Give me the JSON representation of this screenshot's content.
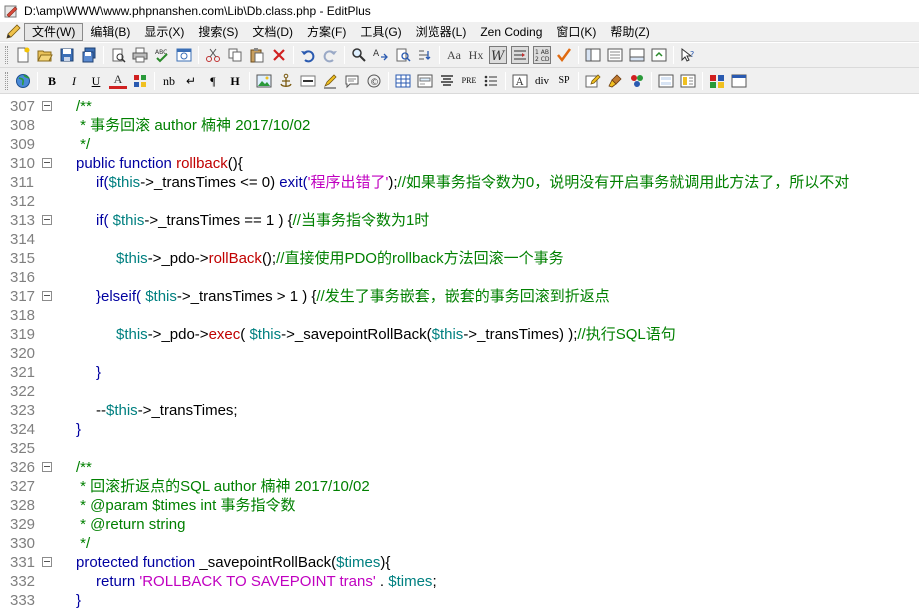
{
  "window": {
    "title": "D:\\amp\\WWW\\www.phpnanshen.com\\Lib\\Db.class.php - EditPlus"
  },
  "menu": [
    {
      "label": "文件(W)",
      "active": true
    },
    {
      "label": "编辑(B)"
    },
    {
      "label": "显示(X)"
    },
    {
      "label": "搜索(S)"
    },
    {
      "label": "文档(D)"
    },
    {
      "label": "方案(F)"
    },
    {
      "label": "工具(G)"
    },
    {
      "label": "浏览器(L)"
    },
    {
      "label": "Zen Coding"
    },
    {
      "label": "窗口(K)"
    },
    {
      "label": "帮助(Z)"
    }
  ],
  "toolbar2_labels": {
    "bold": "B",
    "italic": "I",
    "underline": "U",
    "font_color": "A",
    "nbsp": "nb",
    "line_break": "↵",
    "paragraph": "¶",
    "heading": "H",
    "pre": "PRE",
    "div": "div",
    "span": "SP"
  },
  "toolbar1_labels": {
    "font": "Aa",
    "hex": "Hx"
  },
  "colors": {
    "comment": "#008000",
    "keyword": "#0000a0",
    "function": "#c00000",
    "variable": "#008080",
    "string": "#c000c0",
    "line_number": "#7f7f7f"
  },
  "lines": [
    {
      "n": "307",
      "fold": true,
      "indent": 0,
      "tokens": [
        [
          "cm",
          "/**"
        ]
      ]
    },
    {
      "n": "308",
      "fold": false,
      "indent": 0,
      "tokens": [
        [
          "cm",
          " * 事务回滚 author 楠神 2017/10/02"
        ]
      ]
    },
    {
      "n": "309",
      "fold": false,
      "indent": 0,
      "tokens": [
        [
          "cm",
          " */"
        ]
      ]
    },
    {
      "n": "310",
      "fold": true,
      "indent": 0,
      "tokens": [
        [
          "kw",
          "public function "
        ],
        [
          "fn",
          "rollback"
        ],
        [
          "op",
          "(){"
        ]
      ]
    },
    {
      "n": "311",
      "fold": false,
      "indent": 1,
      "tokens": [
        [
          "kw",
          "if("
        ],
        [
          "var",
          "$this"
        ],
        [
          "op",
          "->_transTimes <= 0) "
        ],
        [
          "kw",
          "exit("
        ],
        [
          "str",
          "'程序出错了'"
        ],
        [
          "op",
          ");"
        ],
        [
          "cm",
          "//如果事务指令数为0，说明没有开启事务就调用此方法了，所以不对"
        ]
      ]
    },
    {
      "n": "312",
      "fold": false,
      "indent": 0,
      "tokens": []
    },
    {
      "n": "313",
      "fold": true,
      "indent": 1,
      "tokens": [
        [
          "kw",
          "if( "
        ],
        [
          "var",
          "$this"
        ],
        [
          "op",
          "->_transTimes == 1 ) {"
        ],
        [
          "cm",
          "//当事务指令数为1时"
        ]
      ]
    },
    {
      "n": "314",
      "fold": false,
      "indent": 0,
      "tokens": []
    },
    {
      "n": "315",
      "fold": false,
      "indent": 2,
      "tokens": [
        [
          "var",
          "$this"
        ],
        [
          "op",
          "->_pdo->"
        ],
        [
          "fn",
          "rollBack"
        ],
        [
          "op",
          "();"
        ],
        [
          "cm",
          "//直接使用PDO的rollback方法回滚一个事务"
        ]
      ]
    },
    {
      "n": "316",
      "fold": false,
      "indent": 0,
      "tokens": []
    },
    {
      "n": "317",
      "fold": true,
      "indent": 1,
      "tokens": [
        [
          "kw",
          "}elseif( "
        ],
        [
          "var",
          "$this"
        ],
        [
          "op",
          "->_transTimes > 1 ) {"
        ],
        [
          "cm",
          "//发生了事务嵌套，嵌套的事务回滚到折返点"
        ]
      ]
    },
    {
      "n": "318",
      "fold": false,
      "indent": 0,
      "tokens": []
    },
    {
      "n": "319",
      "fold": false,
      "indent": 2,
      "tokens": [
        [
          "var",
          "$this"
        ],
        [
          "op",
          "->_pdo->"
        ],
        [
          "fn",
          "exec"
        ],
        [
          "op",
          "( "
        ],
        [
          "var",
          "$this"
        ],
        [
          "op",
          "->_savepointRollBack("
        ],
        [
          "var",
          "$this"
        ],
        [
          "op",
          "->_transTimes) );"
        ],
        [
          "cm",
          "//执行SQL语句"
        ]
      ]
    },
    {
      "n": "320",
      "fold": false,
      "indent": 0,
      "tokens": []
    },
    {
      "n": "321",
      "fold": false,
      "indent": 1,
      "tokens": [
        [
          "kw",
          "}"
        ]
      ]
    },
    {
      "n": "322",
      "fold": false,
      "indent": 0,
      "tokens": []
    },
    {
      "n": "323",
      "fold": false,
      "indent": 1,
      "tokens": [
        [
          "op",
          "--"
        ],
        [
          "var",
          "$this"
        ],
        [
          "op",
          "->_transTimes;"
        ]
      ]
    },
    {
      "n": "324",
      "fold": false,
      "indent": 0,
      "tokens": [
        [
          "kw",
          "}"
        ]
      ]
    },
    {
      "n": "325",
      "fold": false,
      "indent": 0,
      "tokens": []
    },
    {
      "n": "326",
      "fold": true,
      "indent": 0,
      "tokens": [
        [
          "cm",
          "/**"
        ]
      ]
    },
    {
      "n": "327",
      "fold": false,
      "indent": 0,
      "tokens": [
        [
          "cm",
          " * 回滚折返点的SQL author 楠神 2017/10/02"
        ]
      ]
    },
    {
      "n": "328",
      "fold": false,
      "indent": 0,
      "tokens": [
        [
          "cm",
          " * @param $times int 事务指令数"
        ]
      ]
    },
    {
      "n": "329",
      "fold": false,
      "indent": 0,
      "tokens": [
        [
          "cm",
          " * @return string"
        ]
      ]
    },
    {
      "n": "330",
      "fold": false,
      "indent": 0,
      "tokens": [
        [
          "cm",
          " */"
        ]
      ]
    },
    {
      "n": "331",
      "fold": true,
      "indent": 0,
      "tokens": [
        [
          "kw",
          "protected function "
        ],
        [
          "op",
          "_savepointRollBack("
        ],
        [
          "var",
          "$times"
        ],
        [
          "op",
          "){"
        ]
      ]
    },
    {
      "n": "332",
      "fold": false,
      "indent": 1,
      "tokens": [
        [
          "kw",
          "return "
        ],
        [
          "str",
          "'ROLLBACK TO SAVEPOINT trans'"
        ],
        [
          "op",
          " . "
        ],
        [
          "var",
          "$times"
        ],
        [
          "op",
          ";"
        ]
      ]
    },
    {
      "n": "333",
      "fold": false,
      "indent": 0,
      "tokens": [
        [
          "kw",
          "}"
        ]
      ]
    }
  ]
}
